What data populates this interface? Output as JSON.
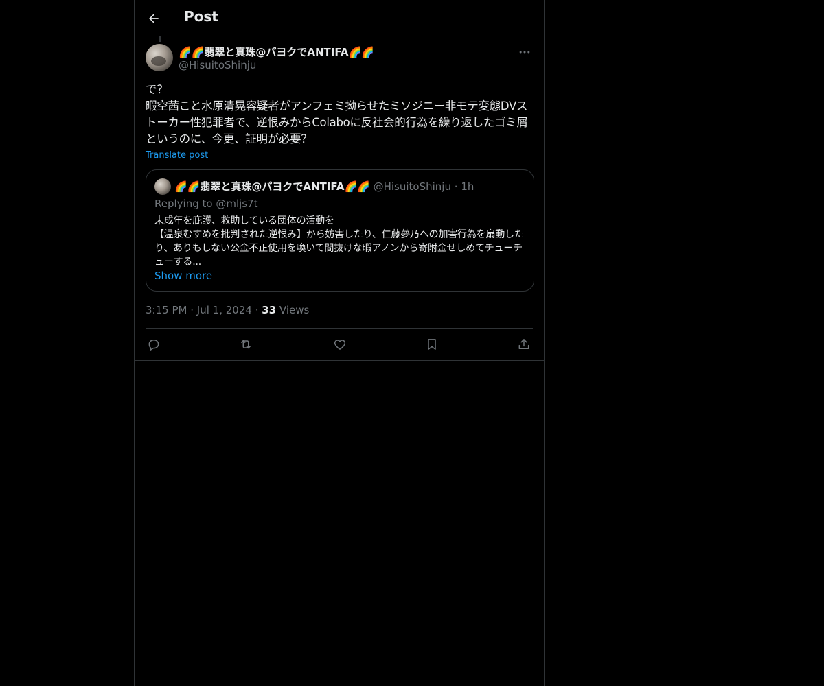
{
  "header": {
    "title": "Post"
  },
  "post": {
    "author_name": "🌈🌈翡翠と真珠@パヨクでANTIFA🌈🌈",
    "author_handle": "@HisuitoShinju",
    "text": "で？\n暇空茜こと水原清晃容疑者がアンフェミ拗らせたミソジニー非モテ変態DVストーカー性犯罪者で、逆恨みからColaboに反社会的行為を繰り返したゴミ屑というのに、今更、証明が必要？",
    "translate_label": "Translate post",
    "time": "3:15 PM",
    "date": "Jul 1, 2024",
    "views_count": "33",
    "views_label": "Views",
    "separator": "·"
  },
  "quote": {
    "author_name": "🌈🌈翡翠と真珠@パヨクでANTIFA🌈🌈",
    "author_handle": "@HisuitoShinju",
    "separator": "·",
    "time": "1h",
    "replying_label": "Replying to",
    "replying_handle": "@mljs7t",
    "text": "未成年を庇護、救助している団体の活動を\n【温泉むすめを批判された逆恨み】から妨害したり、仁藤夢乃への加害行為を扇動したり、ありもしない公金不正使用を喚いて間抜けな暇アノンから寄附金せしめてチューチューする...",
    "show_more_label": "Show more"
  },
  "icons": {
    "back": "arrow-left-icon",
    "more": "more-horizontal-icon",
    "reply": "reply-icon",
    "repost": "repost-icon",
    "like": "heart-icon",
    "bookmark": "bookmark-icon",
    "share": "share-icon"
  },
  "colors": {
    "background": "#000000",
    "text": "#e7e9ea",
    "muted": "#71767b",
    "accent": "#1d9bf0",
    "border": "#2f3336"
  }
}
